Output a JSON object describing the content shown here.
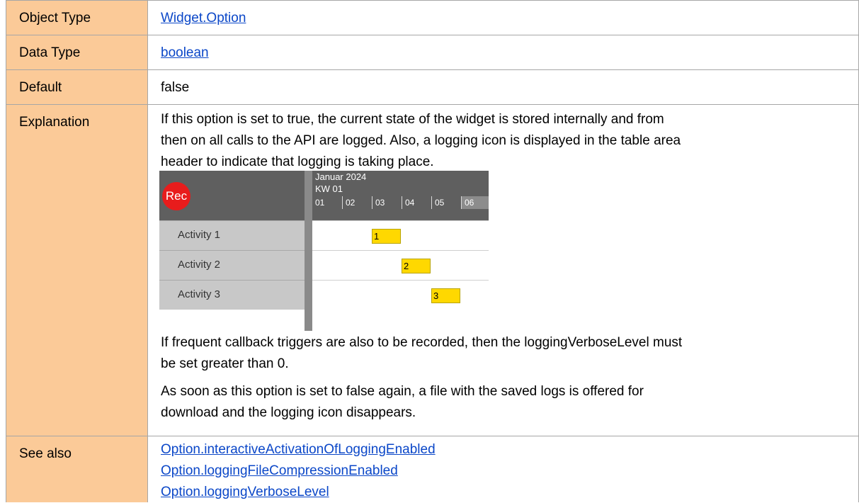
{
  "rows": {
    "object_type": {
      "label": "Object Type",
      "value": "Widget.Option"
    },
    "data_type": {
      "label": "Data Type",
      "value": "boolean"
    },
    "default": {
      "label": "Default",
      "value": "false"
    },
    "explanation": {
      "label": "Explanation",
      "para1_line1": "If this option is set to true, the current state of the widget is stored internally and from",
      "para1_line2": "then on all calls to the API are logged. Also, a logging icon is displayed in the table area",
      "para1_line3": "header to indicate that logging is taking place.",
      "para2_line1": "If frequent callback triggers are also to be recorded, then the loggingVerboseLevel must",
      "para2_line2": "be set greater than 0.",
      "para3_line1": "As soon as this option is set to false again, a file with the saved logs is offered for",
      "para3_line2": "download and the logging icon disappears."
    },
    "see_also": {
      "label": "See also",
      "links": [
        "Option.interactiveActivationOfLoggingEnabled",
        "Option.loggingFileCompressionEnabled",
        "Option.loggingVerboseLevel"
      ]
    }
  },
  "gantt": {
    "rec_label": "Rec",
    "month": "Januar 2024",
    "week": "KW 01",
    "days": [
      "01",
      "02",
      "03",
      "04",
      "05",
      "06"
    ],
    "activities": [
      {
        "name": "Activity 1",
        "bar_label": "1"
      },
      {
        "name": "Activity 2",
        "bar_label": "2"
      },
      {
        "name": "Activity 3",
        "bar_label": "3"
      }
    ],
    "colors": {
      "header": "#5f5f5f",
      "rec": "#e81c1c",
      "bar": "#ffd800",
      "label_bg": "#fbca98",
      "link": "#0b47c8"
    }
  }
}
